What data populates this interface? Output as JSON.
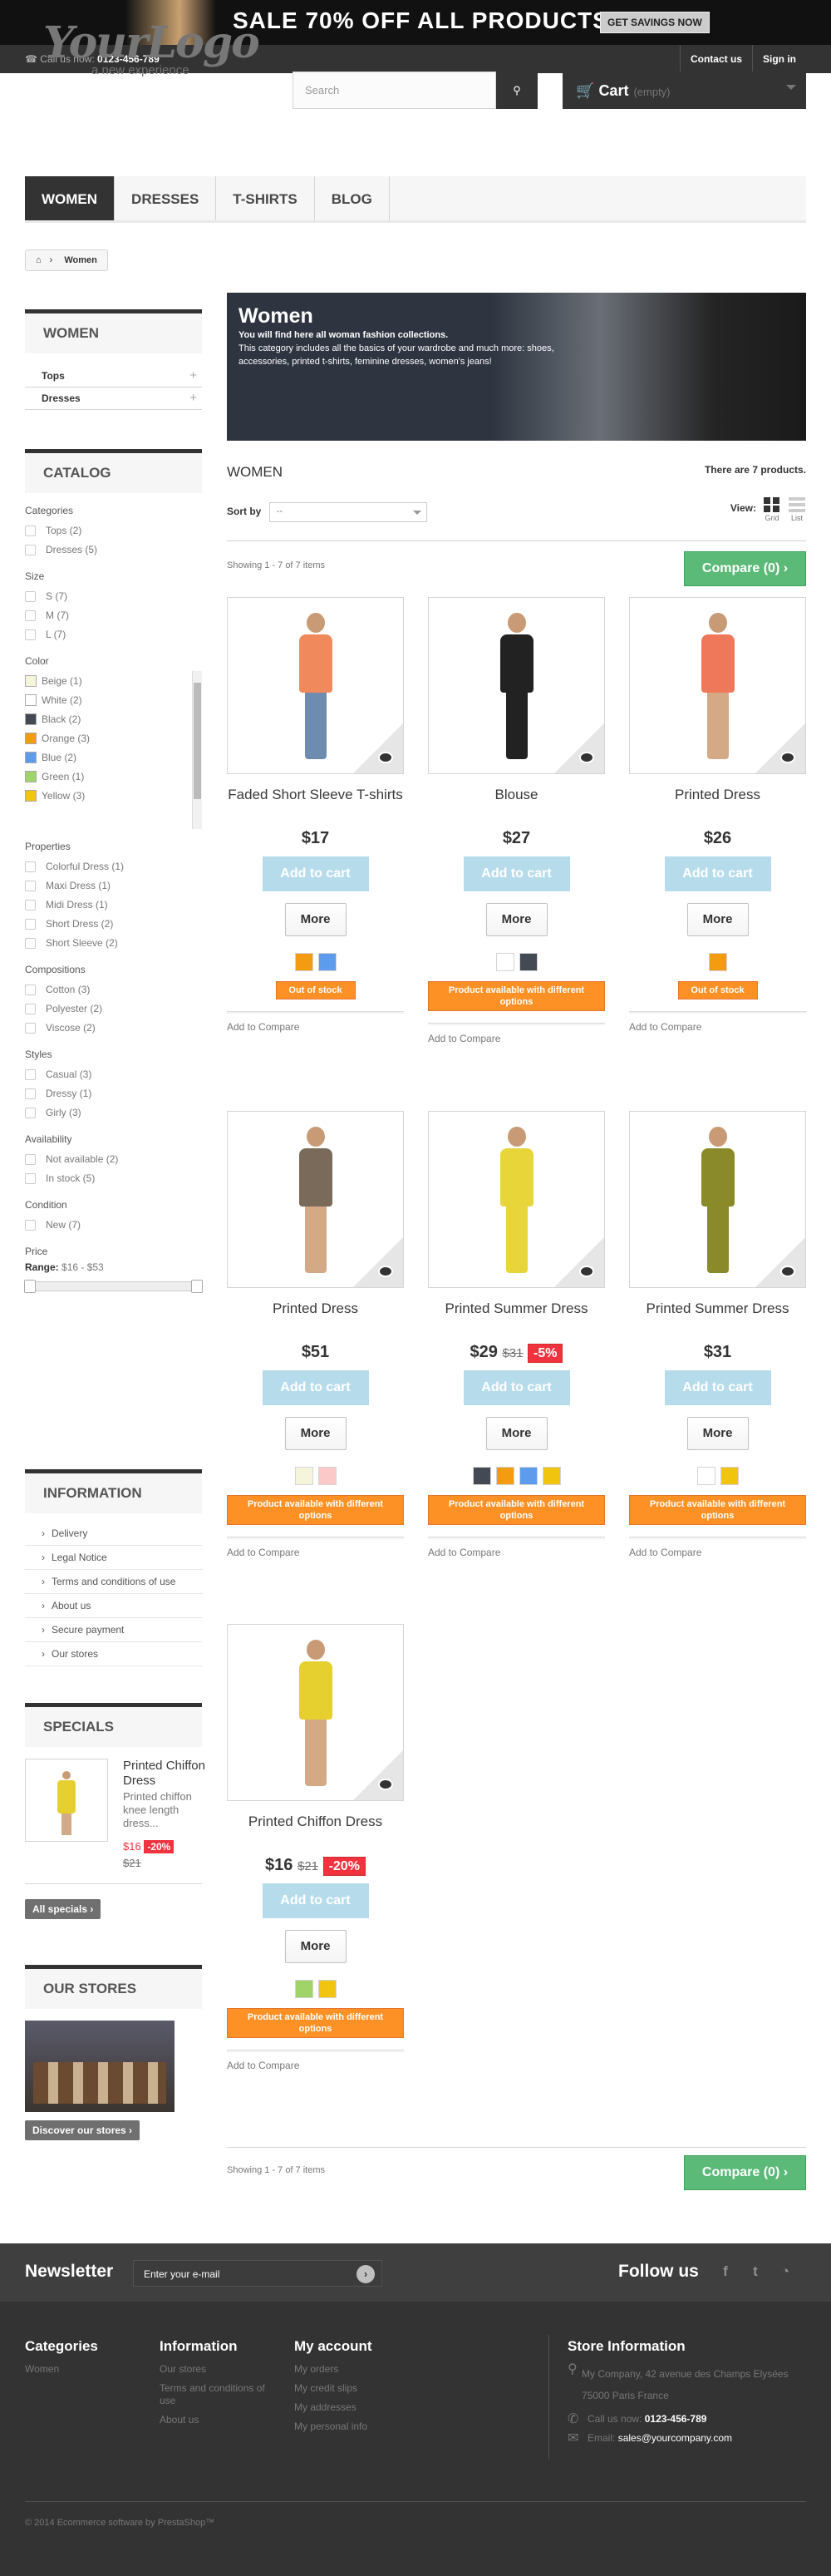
{
  "banner": {
    "text": "SALE 70% OFF ALL PRODUCTS",
    "button": "GET SAVINGS NOW"
  },
  "topnav": {
    "call_label": "Call us now:",
    "phone": "0123-456-789",
    "contact": "Contact us",
    "signin": "Sign in"
  },
  "logo": {
    "main": "YourLogo",
    "tagline": "a new experience"
  },
  "search": {
    "placeholder": "Search"
  },
  "cart": {
    "label": "Cart",
    "status": "(empty)"
  },
  "menu": [
    "WOMEN",
    "DRESSES",
    "T-SHIRTS",
    "BLOG"
  ],
  "breadcrumb": {
    "current": "Women"
  },
  "sidebar": {
    "women_title": "WOMEN",
    "categories": [
      "Tops",
      "Dresses"
    ],
    "catalog_title": "CATALOG",
    "filters": [
      {
        "title": "Categories",
        "options": [
          "Tops (2)",
          "Dresses (5)"
        ]
      },
      {
        "title": "Size",
        "options": [
          "S (7)",
          "M (7)",
          "L (7)"
        ]
      }
    ],
    "color_title": "Color",
    "colors": [
      {
        "label": "Beige (1)",
        "hex": "#f5f5dc"
      },
      {
        "label": "White (2)",
        "hex": "#ffffff"
      },
      {
        "label": "Black (2)",
        "hex": "#434a54"
      },
      {
        "label": "Orange (3)",
        "hex": "#f39c11"
      },
      {
        "label": "Blue (2)",
        "hex": "#5d9cec"
      },
      {
        "label": "Green (1)",
        "hex": "#a0d468"
      },
      {
        "label": "Yellow (3)",
        "hex": "#f1c40f"
      }
    ],
    "filters2": [
      {
        "title": "Properties",
        "options": [
          "Colorful Dress (1)",
          "Maxi Dress (1)",
          "Midi Dress (1)",
          "Short Dress (2)",
          "Short Sleeve (2)"
        ]
      },
      {
        "title": "Compositions",
        "options": [
          "Cotton (3)",
          "Polyester (2)",
          "Viscose (2)"
        ]
      },
      {
        "title": "Styles",
        "options": [
          "Casual (3)",
          "Dressy (1)",
          "Girly (3)"
        ]
      },
      {
        "title": "Availability",
        "options": [
          "Not available (2)",
          "In stock (5)"
        ]
      },
      {
        "title": "Condition",
        "options": [
          "New (7)"
        ]
      }
    ],
    "price_title": "Price",
    "price_range_label": "Range:",
    "price_range": "$16 - $53",
    "info_title": "INFORMATION",
    "info_links": [
      "Delivery",
      "Legal Notice",
      "Terms and conditions of use",
      "About us",
      "Secure payment",
      "Our stores"
    ],
    "specials_title": "SPECIALS",
    "special": {
      "name": "Printed Chiffon Dress",
      "desc": "Printed chiffon knee length dress...",
      "price": "$16",
      "old": "$21",
      "disc": "-20%"
    },
    "all_specials": "All specials",
    "stores_title": "OUR STORES",
    "discover": "Discover our stores"
  },
  "category": {
    "title": "Women",
    "desc_bold": "You will find here all woman fashion collections.",
    "desc": "This category includes all the basics of your wardrobe and much more: shoes, accessories, printed t-shirts, feminine dresses, women's jeans!",
    "heading": "WOMEN",
    "count": "There are 7 products.",
    "sort_label": "Sort by",
    "sort_value": "--",
    "view_label": "View:",
    "grid": "Grid",
    "list": "List",
    "showing": "Showing 1 - 7 of 7 items",
    "compare": "Compare (0)"
  },
  "products": [
    {
      "name": "Faded Short Sleeve T-shirts",
      "price": "$17",
      "old": "",
      "disc": "",
      "swatches": [
        "#f39c11",
        "#5d9cec"
      ],
      "avail": "Out of stock",
      "oos": true,
      "body": "#f08a5d",
      "legs": "#6e8bb0"
    },
    {
      "name": "Blouse",
      "price": "$27",
      "old": "",
      "disc": "",
      "swatches": [
        "#ffffff",
        "#434a54"
      ],
      "avail": "Product available with different options",
      "oos": false,
      "body": "#222222",
      "legs": "#222222"
    },
    {
      "name": "Printed Dress",
      "price": "$26",
      "old": "",
      "disc": "",
      "swatches": [
        "#f39c11"
      ],
      "avail": "Out of stock",
      "oos": true,
      "body": "#f0785a",
      "legs": "#d4a986"
    },
    {
      "name": "Printed Dress",
      "price": "$51",
      "old": "",
      "disc": "",
      "swatches": [
        "#f5f5dc",
        "#fcc9c9"
      ],
      "avail": "Product available with different options",
      "oos": false,
      "body": "#7a6a5a",
      "legs": "#d4a986"
    },
    {
      "name": "Printed Summer Dress",
      "price": "$29",
      "old": "$31",
      "disc": "-5%",
      "swatches": [
        "#434a54",
        "#f39c11",
        "#5d9cec",
        "#f1c40f"
      ],
      "avail": "Product available with different options",
      "oos": false,
      "body": "#e8d53a",
      "legs": "#e8d53a"
    },
    {
      "name": "Printed Summer Dress",
      "price": "$31",
      "old": "",
      "disc": "",
      "swatches": [
        "#ffffff",
        "#f1c40f"
      ],
      "avail": "Product available with different options",
      "oos": false,
      "body": "#8a8a2a",
      "legs": "#8a8a2a"
    },
    {
      "name": "Printed Chiffon Dress",
      "price": "$16",
      "old": "$21",
      "disc": "-20%",
      "swatches": [
        "#a0d468",
        "#f1c40f"
      ],
      "avail": "Product available with different options",
      "oos": false,
      "body": "#e6d030",
      "legs": "#d4a986"
    }
  ],
  "add_to_cart": "Add to cart",
  "more": "More",
  "add_to_compare": "Add to Compare",
  "newsletter": {
    "title": "Newsletter",
    "placeholder": "Enter your e-mail",
    "follow": "Follow us"
  },
  "footer": {
    "categories_title": "Categories",
    "categories": [
      "Women"
    ],
    "info_title": "Information",
    "info": [
      "Our stores",
      "Terms and conditions of use",
      "About us"
    ],
    "account_title": "My account",
    "account": [
      "My orders",
      "My credit slips",
      "My addresses",
      "My personal info"
    ],
    "store_title": "Store Information",
    "address": "My Company, 42 avenue des Champs Elysées 75000 Paris France",
    "call_label": "Call us now:",
    "phone": "0123-456-789",
    "email_label": "Email:",
    "email": "sales@yourcompany.com",
    "copyright": "© 2014 Ecommerce software by PrestaShop™"
  }
}
